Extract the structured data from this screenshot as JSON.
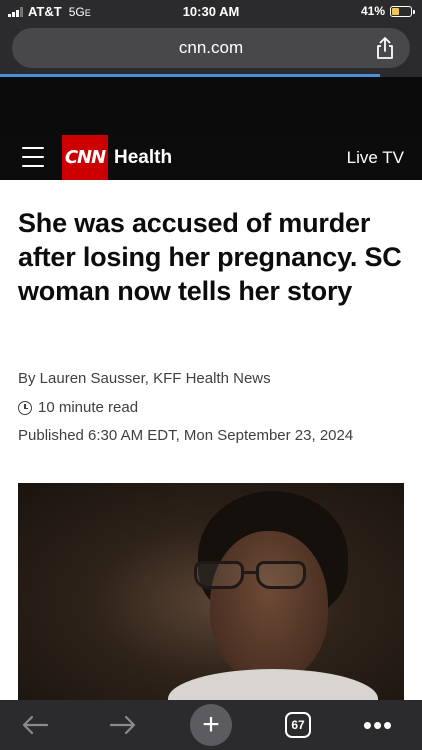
{
  "status_bar": {
    "carrier": "AT&T",
    "network": "5G",
    "network_suffix": "E",
    "time": "10:30 AM",
    "battery_percent": "41%",
    "battery_level": 0.41,
    "battery_color": "#f2c94c"
  },
  "browser": {
    "url": "cnn.com",
    "share_icon": "share-icon",
    "page_load_progress": 0.9,
    "progress_color": "#4a8fd8"
  },
  "site_header": {
    "menu_icon": "hamburger-menu-icon",
    "logo_text": "CNN",
    "logo_color": "#cc0000",
    "section": "Health",
    "live_tv_label": "Live TV"
  },
  "article": {
    "headline": "She was accused of murder after losing her pregnancy. SC woman now tells her story",
    "byline": "By Lauren Sausser, KFF Health News",
    "read_time": "10 minute read",
    "clock_icon": "clock-icon",
    "published": "Published 6:30 AM EDT, Mon September 23, 2024"
  },
  "toolbar": {
    "back_icon": "back-arrow-icon",
    "forward_icon": "forward-arrow-icon",
    "new_tab_icon": "plus-icon",
    "new_tab_glyph": "+",
    "tab_count": "67",
    "more_glyph": "•••"
  }
}
